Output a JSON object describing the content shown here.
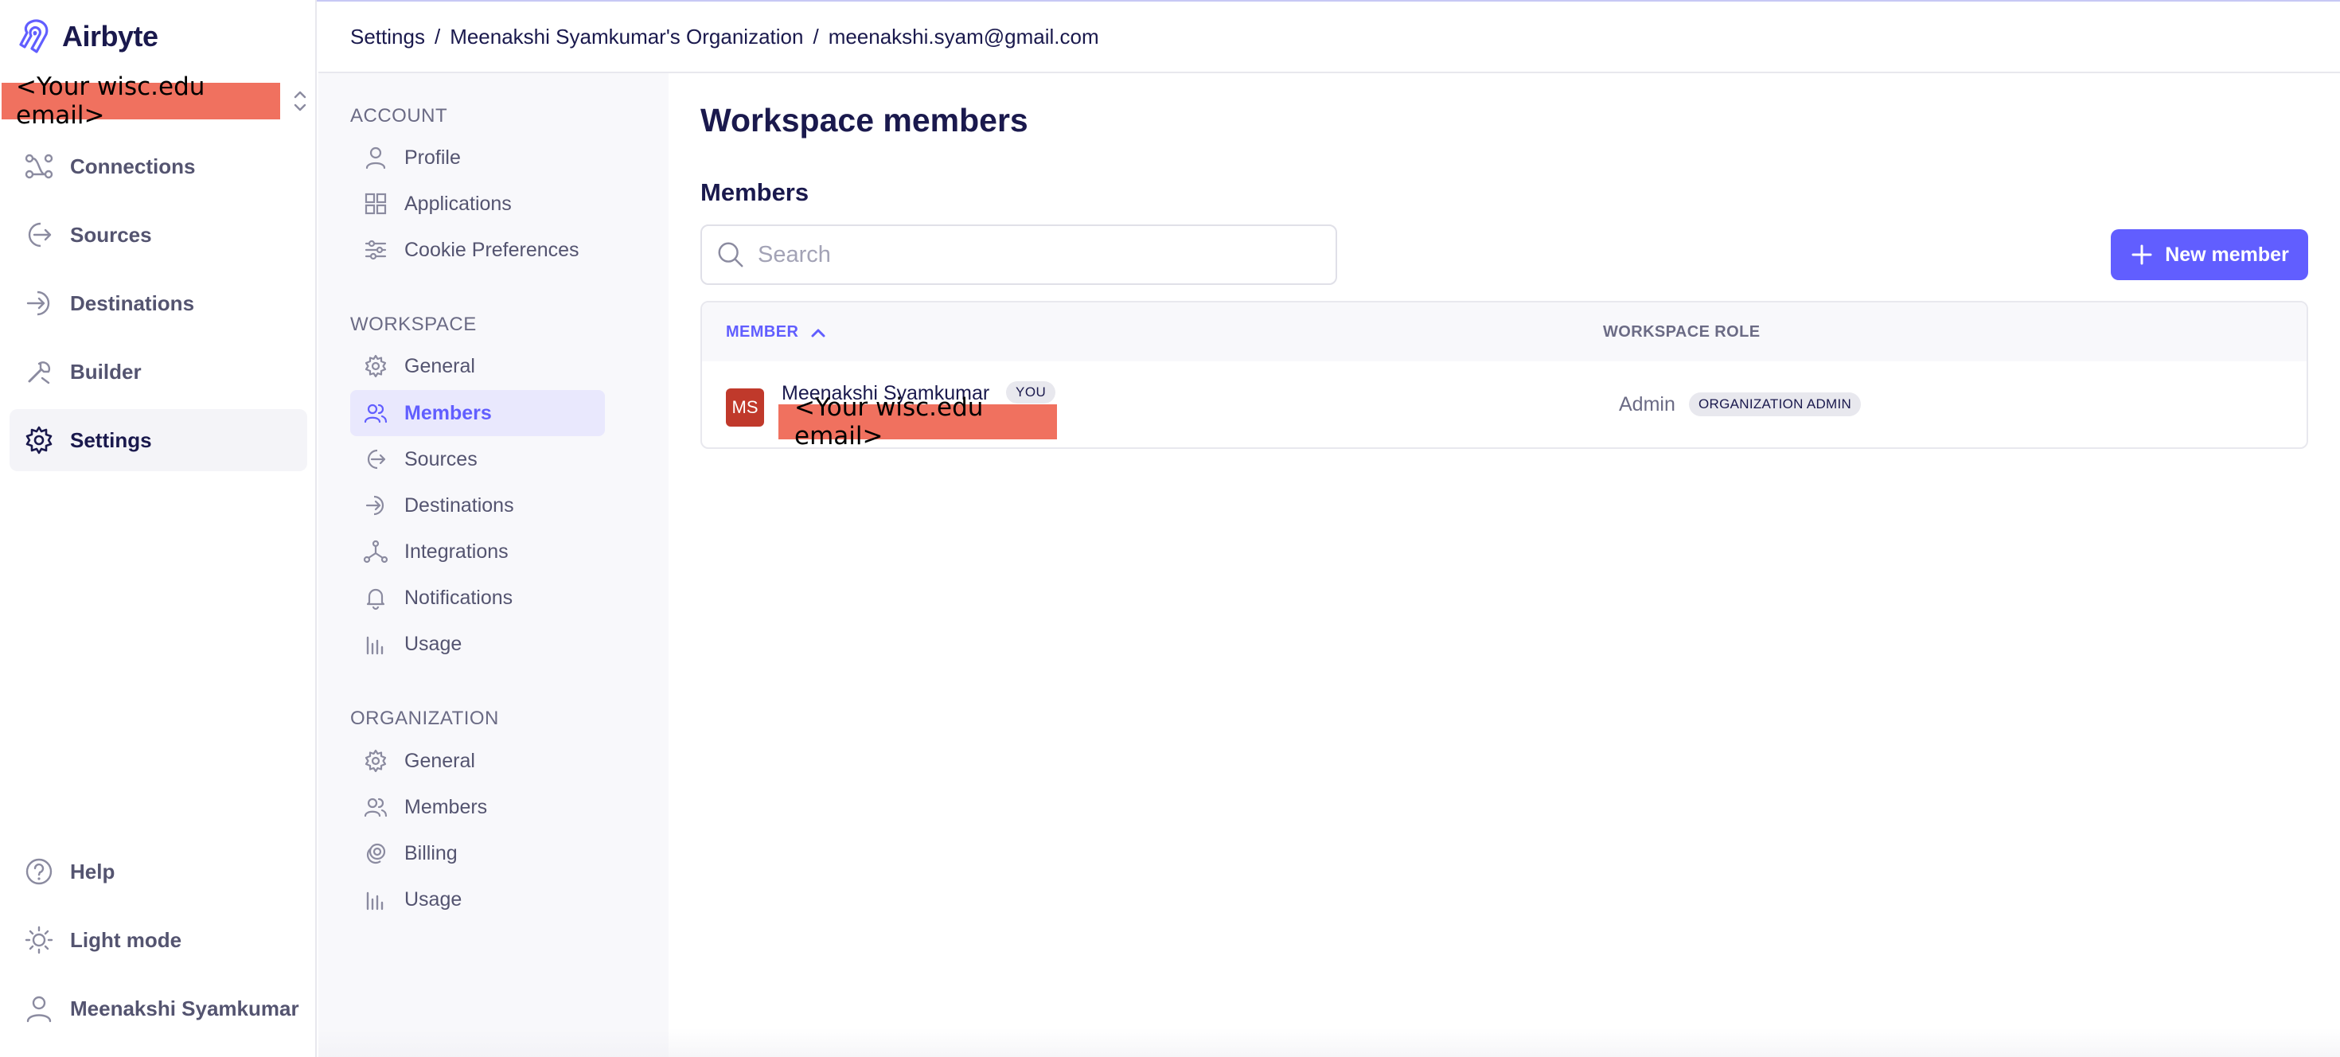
{
  "app": {
    "name": "Airbyte",
    "workspace_redacted": "<Your wisc.edu email>"
  },
  "colors": {
    "accent": "#615eff",
    "text_primary": "#1a194d",
    "text_muted": "#6b6b85",
    "redaction": "#f0715f",
    "avatar": "#c0392b"
  },
  "leftnav": {
    "items": [
      {
        "label": "Connections",
        "icon": "connections-icon"
      },
      {
        "label": "Sources",
        "icon": "sources-icon"
      },
      {
        "label": "Destinations",
        "icon": "destinations-icon"
      },
      {
        "label": "Builder",
        "icon": "builder-icon"
      },
      {
        "label": "Settings",
        "icon": "gear-icon",
        "active": true
      }
    ],
    "bottom": [
      {
        "label": "Help",
        "icon": "help-icon"
      },
      {
        "label": "Light mode",
        "icon": "sun-icon"
      },
      {
        "label": "Meenakshi Syamkumar",
        "icon": "user-icon"
      }
    ]
  },
  "breadcrumb": {
    "items": [
      "Settings",
      "Meenakshi Syamkumar's Organization",
      "meenakshi.syam@gmail.com"
    ],
    "separator": "/"
  },
  "subnav": {
    "account": {
      "heading": "ACCOUNT",
      "items": [
        "Profile",
        "Applications",
        "Cookie Preferences"
      ]
    },
    "workspace": {
      "heading": "WORKSPACE",
      "items": [
        "General",
        "Members",
        "Sources",
        "Destinations",
        "Integrations",
        "Notifications",
        "Usage"
      ],
      "active": "Members"
    },
    "organization": {
      "heading": "ORGANIZATION",
      "items": [
        "General",
        "Members",
        "Billing",
        "Usage"
      ]
    }
  },
  "main": {
    "title": "Workspace members",
    "section": "Members",
    "search_placeholder": "Search",
    "new_member_label": "New member",
    "table": {
      "columns": [
        "MEMBER",
        "WORKSPACE ROLE"
      ],
      "rows": [
        {
          "initials": "MS",
          "name": "Meenakshi Syamkumar",
          "you_badge": "YOU",
          "email_redacted": "<Your wisc.edu email>",
          "role": "Admin",
          "role_badge": "ORGANIZATION ADMIN"
        }
      ]
    }
  }
}
